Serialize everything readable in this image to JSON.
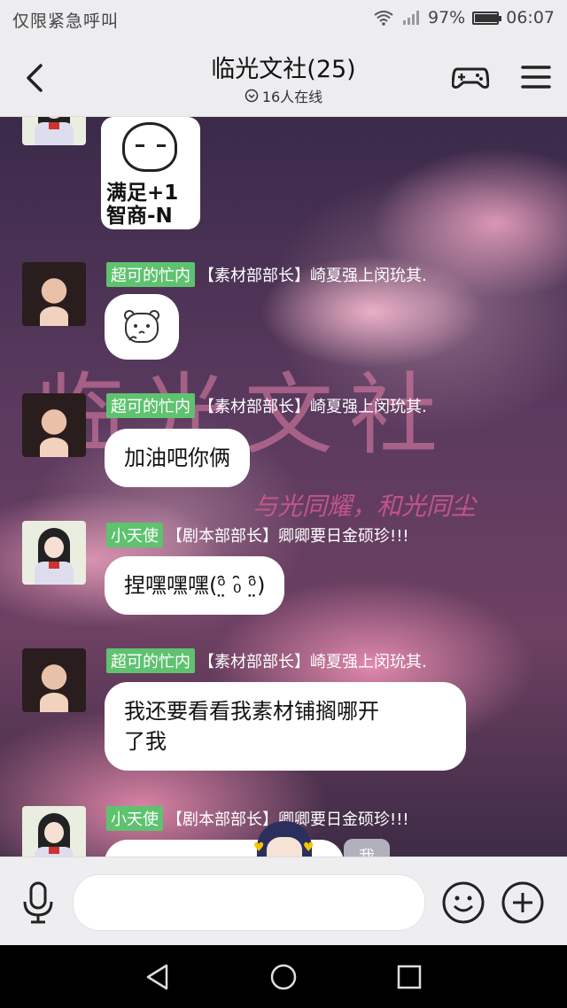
{
  "status_bar": {
    "carrier_text": "仅限紧急呼叫",
    "battery": "97%",
    "battery_level": 0.97,
    "time": "06:07"
  },
  "header": {
    "title": "临光文社(25)",
    "online": "16人在线"
  },
  "background": {
    "title": "临光文社",
    "slogan": "与光同耀，和光同尘"
  },
  "messages": [
    {
      "type": "sticker",
      "line1": "满足+1",
      "line2": "智商-N"
    },
    {
      "type": "emoji",
      "sender_tag": "超可的忙内",
      "sender_name": "【素材部部长】崎夏强上闵玧其."
    },
    {
      "type": "text",
      "sender_tag": "超可的忙内",
      "sender_name": "【素材部部长】崎夏强上闵玧其.",
      "text": "加油吧你俩"
    },
    {
      "type": "text",
      "sender_tag": "小天使",
      "sender_name": "【剧本部部长】卿卿要日金硕珍!!!",
      "text": "捏嘿嘿嘿(ᵒ̤̑ ₀̑ ᵒ̤̑)"
    },
    {
      "type": "text",
      "sender_tag": "超可的忙内",
      "sender_name": "【素材部部长】崎夏强上闵玧其.",
      "text_line1": "我还要看看我素材铺搁哪开",
      "text_line2": "了我"
    },
    {
      "type": "text",
      "sender_tag": "小天使",
      "sender_name": "【剧本部部长】卿卿要日金硕珍!!!",
      "text": ""
    }
  ],
  "me_chip": "我",
  "icons": {
    "back": "chevron-left-icon",
    "online": "check-circle-icon",
    "game": "gamepad-icon",
    "menu": "hamburger-menu-icon",
    "voice": "microphone-icon",
    "emoji": "smiley-icon",
    "more": "plus-circle-icon"
  }
}
